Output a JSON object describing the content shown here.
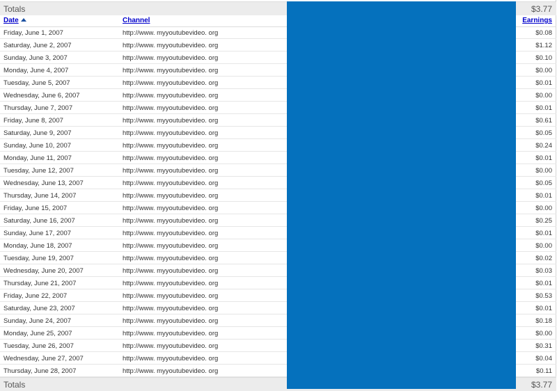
{
  "totals": {
    "label": "Totals",
    "value": "$3.77"
  },
  "columns": {
    "date": "Date",
    "channel": "Channel",
    "earnings": "Earnings"
  },
  "sort_icon": "sort-ascending-arrow",
  "colors": {
    "redaction": "#0571bd",
    "link": "#0000cc",
    "totals_bg": "#ececec"
  },
  "rows": [
    {
      "date": "Friday, June 1, 2007",
      "channel": "http://www. myyoutubevideo. org",
      "earnings": "$0.08"
    },
    {
      "date": "Saturday, June 2, 2007",
      "channel": "http://www. myyoutubevideo. org",
      "earnings": "$1.12"
    },
    {
      "date": "Sunday, June 3, 2007",
      "channel": "http://www. myyoutubevideo. org",
      "earnings": "$0.10"
    },
    {
      "date": "Monday, June 4, 2007",
      "channel": "http://www. myyoutubevideo. org",
      "earnings": "$0.00"
    },
    {
      "date": "Tuesday, June 5, 2007",
      "channel": "http://www. myyoutubevideo. org",
      "earnings": "$0.01"
    },
    {
      "date": "Wednesday, June 6, 2007",
      "channel": "http://www. myyoutubevideo. org",
      "earnings": "$0.00"
    },
    {
      "date": "Thursday, June 7, 2007",
      "channel": "http://www. myyoutubevideo. org",
      "earnings": "$0.01"
    },
    {
      "date": "Friday, June 8, 2007",
      "channel": "http://www. myyoutubevideo. org",
      "earnings": "$0.61"
    },
    {
      "date": "Saturday, June 9, 2007",
      "channel": "http://www. myyoutubevideo. org",
      "earnings": "$0.05"
    },
    {
      "date": "Sunday, June 10, 2007",
      "channel": "http://www. myyoutubevideo. org",
      "earnings": "$0.24"
    },
    {
      "date": "Monday, June 11, 2007",
      "channel": "http://www. myyoutubevideo. org",
      "earnings": "$0.01"
    },
    {
      "date": "Tuesday, June 12, 2007",
      "channel": "http://www. myyoutubevideo. org",
      "earnings": "$0.00"
    },
    {
      "date": "Wednesday, June 13, 2007",
      "channel": "http://www. myyoutubevideo. org",
      "earnings": "$0.05"
    },
    {
      "date": "Thursday, June 14, 2007",
      "channel": "http://www. myyoutubevideo. org",
      "earnings": "$0.01"
    },
    {
      "date": "Friday, June 15, 2007",
      "channel": "http://www. myyoutubevideo. org",
      "earnings": "$0.00"
    },
    {
      "date": "Saturday, June 16, 2007",
      "channel": "http://www. myyoutubevideo. org",
      "earnings": "$0.25"
    },
    {
      "date": "Sunday, June 17, 2007",
      "channel": "http://www. myyoutubevideo. org",
      "earnings": "$0.01"
    },
    {
      "date": "Monday, June 18, 2007",
      "channel": "http://www. myyoutubevideo. org",
      "earnings": "$0.00"
    },
    {
      "date": "Tuesday, June 19, 2007",
      "channel": "http://www. myyoutubevideo. org",
      "earnings": "$0.02"
    },
    {
      "date": "Wednesday, June 20, 2007",
      "channel": "http://www. myyoutubevideo. org",
      "earnings": "$0.03"
    },
    {
      "date": "Thursday, June 21, 2007",
      "channel": "http://www. myyoutubevideo. org",
      "earnings": "$0.01"
    },
    {
      "date": "Friday, June 22, 2007",
      "channel": "http://www. myyoutubevideo. org",
      "earnings": "$0.53"
    },
    {
      "date": "Saturday, June 23, 2007",
      "channel": "http://www. myyoutubevideo. org",
      "earnings": "$0.01"
    },
    {
      "date": "Sunday, June 24, 2007",
      "channel": "http://www. myyoutubevideo. org",
      "earnings": "$0.18"
    },
    {
      "date": "Monday, June 25, 2007",
      "channel": "http://www. myyoutubevideo. org",
      "earnings": "$0.00"
    },
    {
      "date": "Tuesday, June 26, 2007",
      "channel": "http://www. myyoutubevideo. org",
      "earnings": "$0.31"
    },
    {
      "date": "Wednesday, June 27, 2007",
      "channel": "http://www. myyoutubevideo. org",
      "earnings": "$0.04"
    },
    {
      "date": "Thursday, June 28, 2007",
      "channel": "http://www. myyoutubevideo. org",
      "earnings": "$0.11"
    }
  ]
}
